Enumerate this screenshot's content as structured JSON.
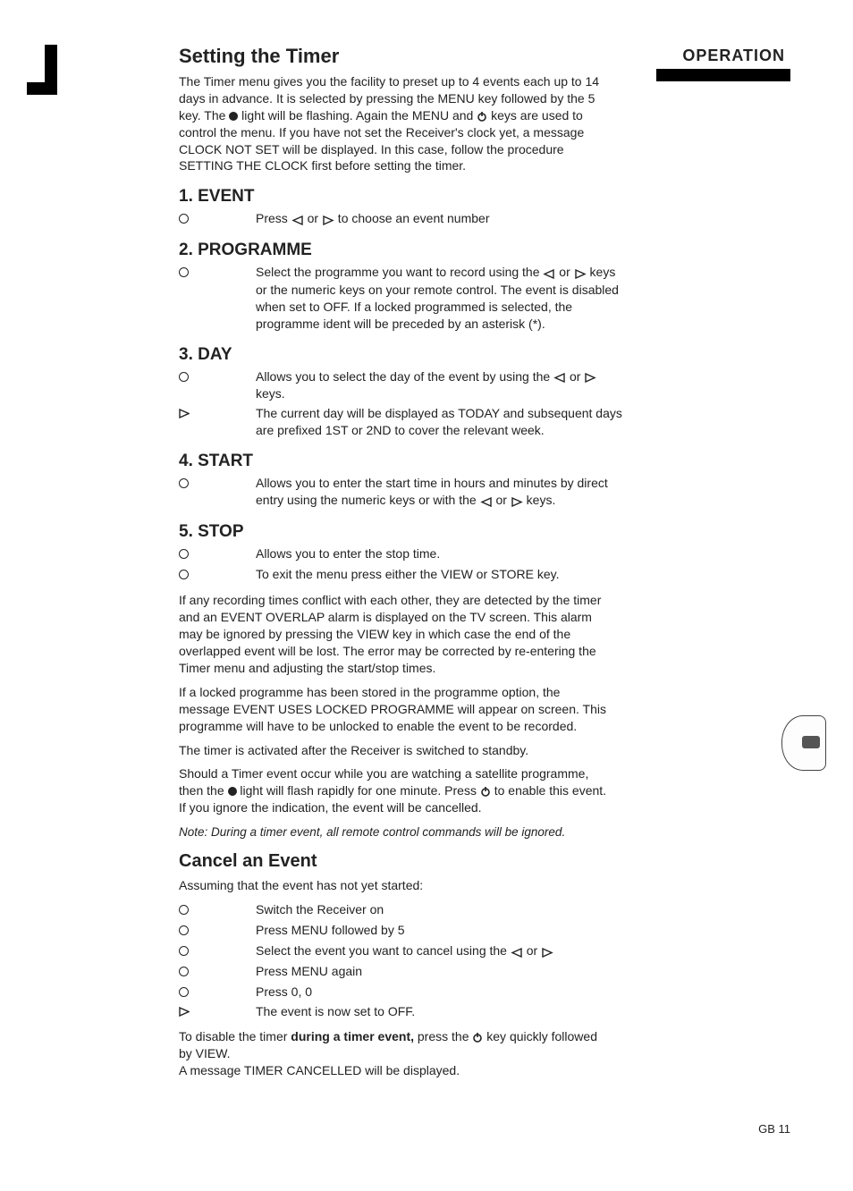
{
  "header": {
    "title": "Setting the Timer",
    "tab": "OPERATION"
  },
  "intro": {
    "part1": "The Timer menu gives you the facility to preset up to 4 events each up to 14 days in advance. It is selected by pressing the MENU key followed by the 5 key. The ",
    "part2": " light will be flashing. Again the MENU and ",
    "part3": " keys are used to control the menu.  If you have not set the Receiver's clock yet, a message CLOCK NOT SET will be displayed.  In this case, follow the procedure SETTING THE CLOCK first before setting the timer."
  },
  "s1": {
    "heading": "1. EVENT",
    "row1a": "Press ",
    "row1b": " or ",
    "row1c": " to choose an event number"
  },
  "s2": {
    "heading": "2. PROGRAMME",
    "row1a": "Select the programme you want to record  using the ",
    "row1b": " or ",
    "row1c": " keys or the numeric keys on your remote control.  The event is disabled when set to OFF. If a locked programmed is selected, the programme ident will be preceded by an asterisk (*)."
  },
  "s3": {
    "heading": "3. DAY",
    "row1a": "Allows you to select the day of the event by using the ",
    "row1b": " or ",
    "row1c": " keys.",
    "row2": "The current day will be displayed as TODAY and subsequent days are prefixed 1ST or 2ND to cover the relevant week."
  },
  "s4": {
    "heading": "4. START",
    "row1a": "Allows you to enter the start time in hours and minutes by direct entry using the numeric keys or  with the ",
    "row1b": " or ",
    "row1c": " keys."
  },
  "s5": {
    "heading": "5. STOP",
    "row1": "Allows you to enter the stop time.",
    "row2": "To exit the menu press either the VIEW or STORE key."
  },
  "paras": {
    "p1": "If any recording times conflict with each other, they are detected by the timer and an EVENT OVERLAP alarm is displayed on the TV screen. This alarm may be ignored by pressing the VIEW key in which case the end of the overlapped event will be lost. The error may be corrected by re-entering the Timer menu and adjusting the start/stop times.",
    "p2": "If a locked programme has been stored in the programme option, the message EVENT USES LOCKED PROGRAMME will appear on screen. This programme will have to be unlocked to enable the event to be recorded.",
    "p3": "The timer is activated after the Receiver is switched to standby.",
    "p4a": "Should a Timer event occur while you are watching a satellite programme, then the ",
    "p4b": " light will flash rapidly for one minute.  Press ",
    "p4c": " to enable this event.  If you ignore the indication, the event will be cancelled."
  },
  "note": "Note: During a timer event, all remote control commands will be ignored.",
  "cancel": {
    "heading": "Cancel an Event",
    "intro": "Assuming that the event has not yet started:",
    "r1": "Switch the Receiver on",
    "r2": "Press MENU followed by 5",
    "r3a": "Select the event you want to cancel using the ",
    "r3b": " or ",
    "r4": "Press MENU again",
    "r5": "Press 0, 0",
    "r6": "The event is now set to OFF.",
    "tail1a": "To disable the timer ",
    "tail1bold": "during a timer event,",
    "tail1b": " press the ",
    "tail1c": " key quickly followed by VIEW.",
    "tail2": "A message TIMER CANCELLED will be displayed."
  },
  "footer": "GB 11"
}
